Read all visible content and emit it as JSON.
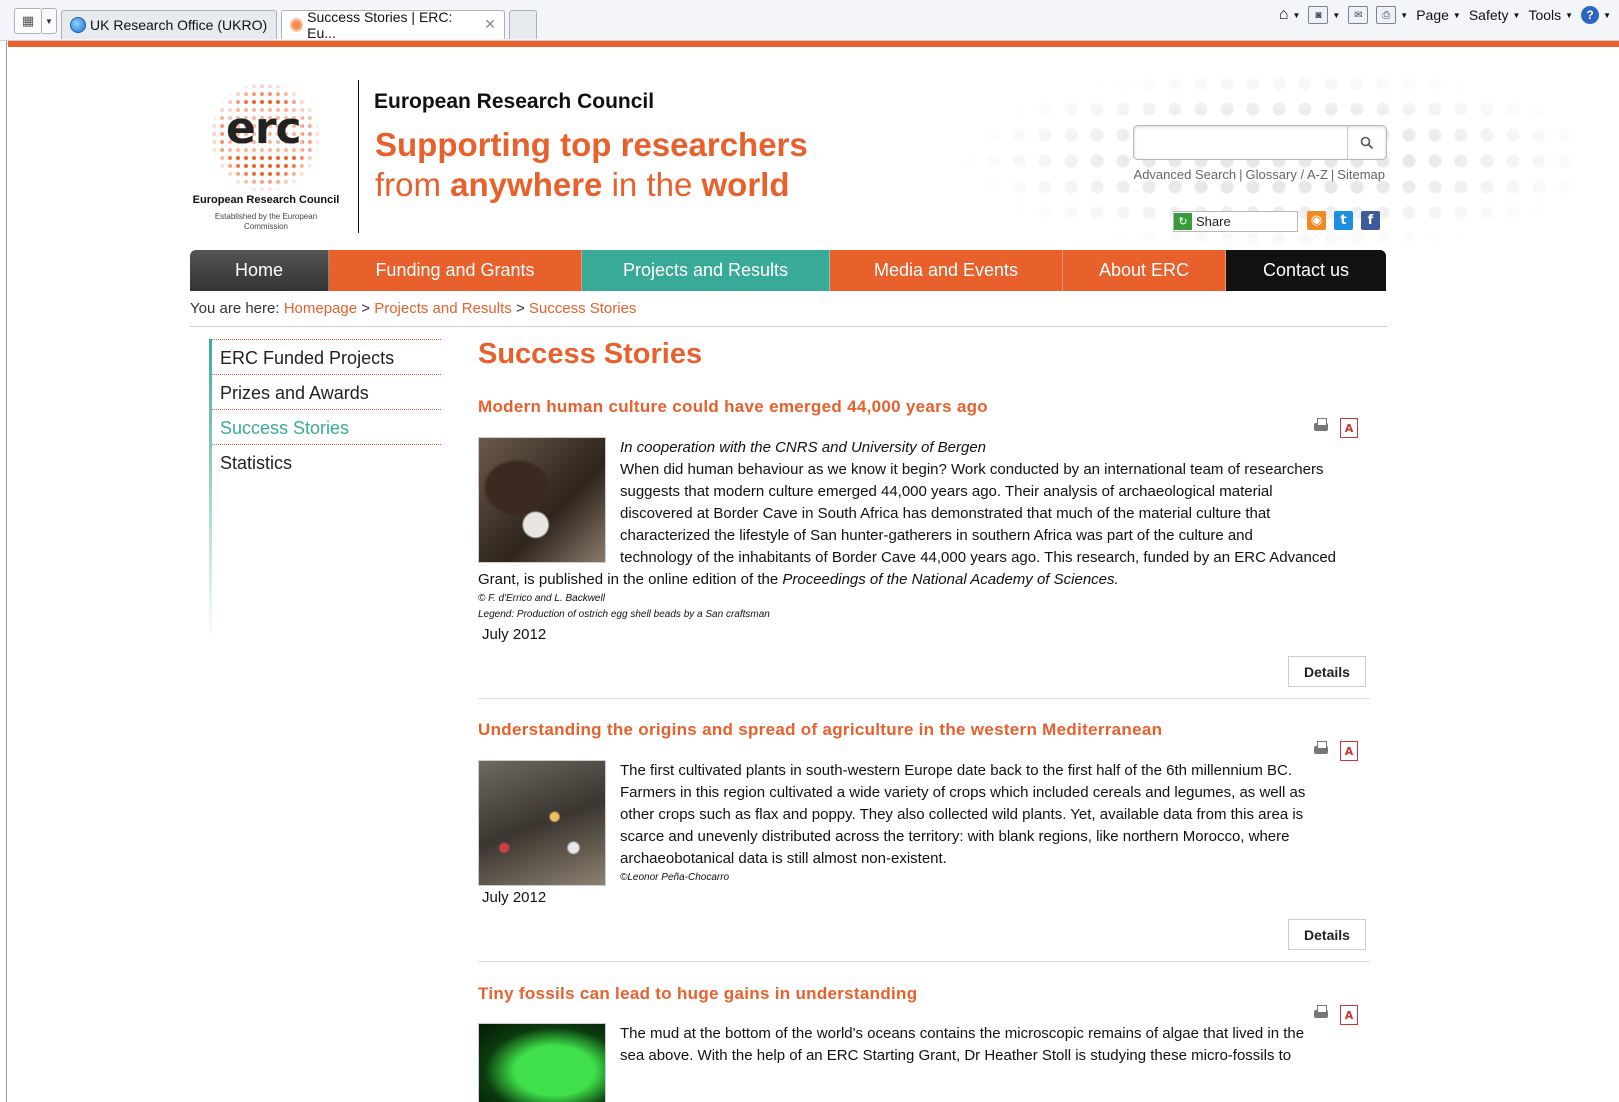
{
  "browser": {
    "tabs": [
      {
        "label": "UK Research Office (UKRO)"
      },
      {
        "label": "Success Stories | ERC: Eu..."
      }
    ],
    "commands": {
      "page": "Page",
      "safety": "Safety",
      "tools": "Tools"
    }
  },
  "header": {
    "logo_text": "erc",
    "logo_caption": "European Research Council",
    "logo_subcaption": "Established by the European Commission",
    "org_name": "European Research Council",
    "tagline_line1": "Supporting top researchers",
    "tagline_from": "from",
    "tagline_anywhere": "anywhere",
    "tagline_in_the": "in the",
    "tagline_world": "world",
    "search": {
      "placeholder": "",
      "value": ""
    },
    "links": [
      "Advanced Search",
      "Glossary / A-Z",
      "Sitemap"
    ],
    "share_label": "Share"
  },
  "nav": {
    "items": [
      "Home",
      "Funding and Grants",
      "Projects and Results",
      "Media and Events",
      "About ERC",
      "Contact us"
    ]
  },
  "breadcrumb": {
    "prefix": "You are here:",
    "items": [
      "Homepage",
      "Projects and Results",
      "Success Stories"
    ],
    "separator": ">"
  },
  "sidebar": {
    "items": [
      "ERC Funded Projects",
      "Prizes and Awards",
      "Success Stories",
      "Statistics"
    ],
    "active_index": 2
  },
  "main": {
    "title": "Success Stories",
    "details_label": "Details",
    "stories": [
      {
        "title": "Modern human culture could have emerged 44,000 years ago",
        "subtitle": "In cooperation with the CNRS and University of Bergen",
        "body_lines": [
          "When did human behaviour as we know it begin? Work conducted by an international team of researchers",
          "suggests that modern culture emerged 44,000 years ago. Their analysis of archaeological material",
          "discovered at Border Cave in South Africa has demonstrated that much of the material culture that",
          "characterized the lifestyle of San hunter-gatherers in southern Africa was part of the culture and",
          "technology of the inhabitants of Border Cave 44,000 years ago. This research, funded by an ERC Advanced"
        ],
        "wrap_prefix": "Grant, is published in the online edition of the ",
        "wrap_italic": "Proceedings of the National Academy of Sciences.",
        "credit": "© F. d'Errico and L. Backwell",
        "legend": "Legend: Production of ostrich egg shell beads by a San craftsman",
        "date": "July 2012"
      },
      {
        "title": "Understanding the origins and spread of agriculture in the western Mediterranean",
        "body_lines": [
          "The first cultivated plants in south-western Europe date back to the first half of the 6th millennium BC.",
          "Farmers in this region cultivated a wide variety of crops which included cereals and legumes, as well as",
          "other crops such as flax and poppy. They also collected wild plants. Yet, available data from this area is",
          "scarce and unevenly distributed across the territory: with blank regions, like northern Morocco, where",
          "archaeobotanical data is still almost non-existent."
        ],
        "credit": "©Leonor Peña-Chocarro",
        "date": "July 2012"
      },
      {
        "title": "Tiny fossils can lead to huge gains in understanding",
        "body_lines": [
          "The mud at the bottom of the world's oceans contains the microscopic remains of algae that lived in the",
          "sea above. With the help of an ERC Starting Grant, Dr Heather Stoll is studying these micro-fossils to"
        ]
      }
    ]
  },
  "colors": {
    "brand_orange": "#e8602c",
    "brand_teal": "#3aaa98",
    "nav_dark": "#111111"
  }
}
